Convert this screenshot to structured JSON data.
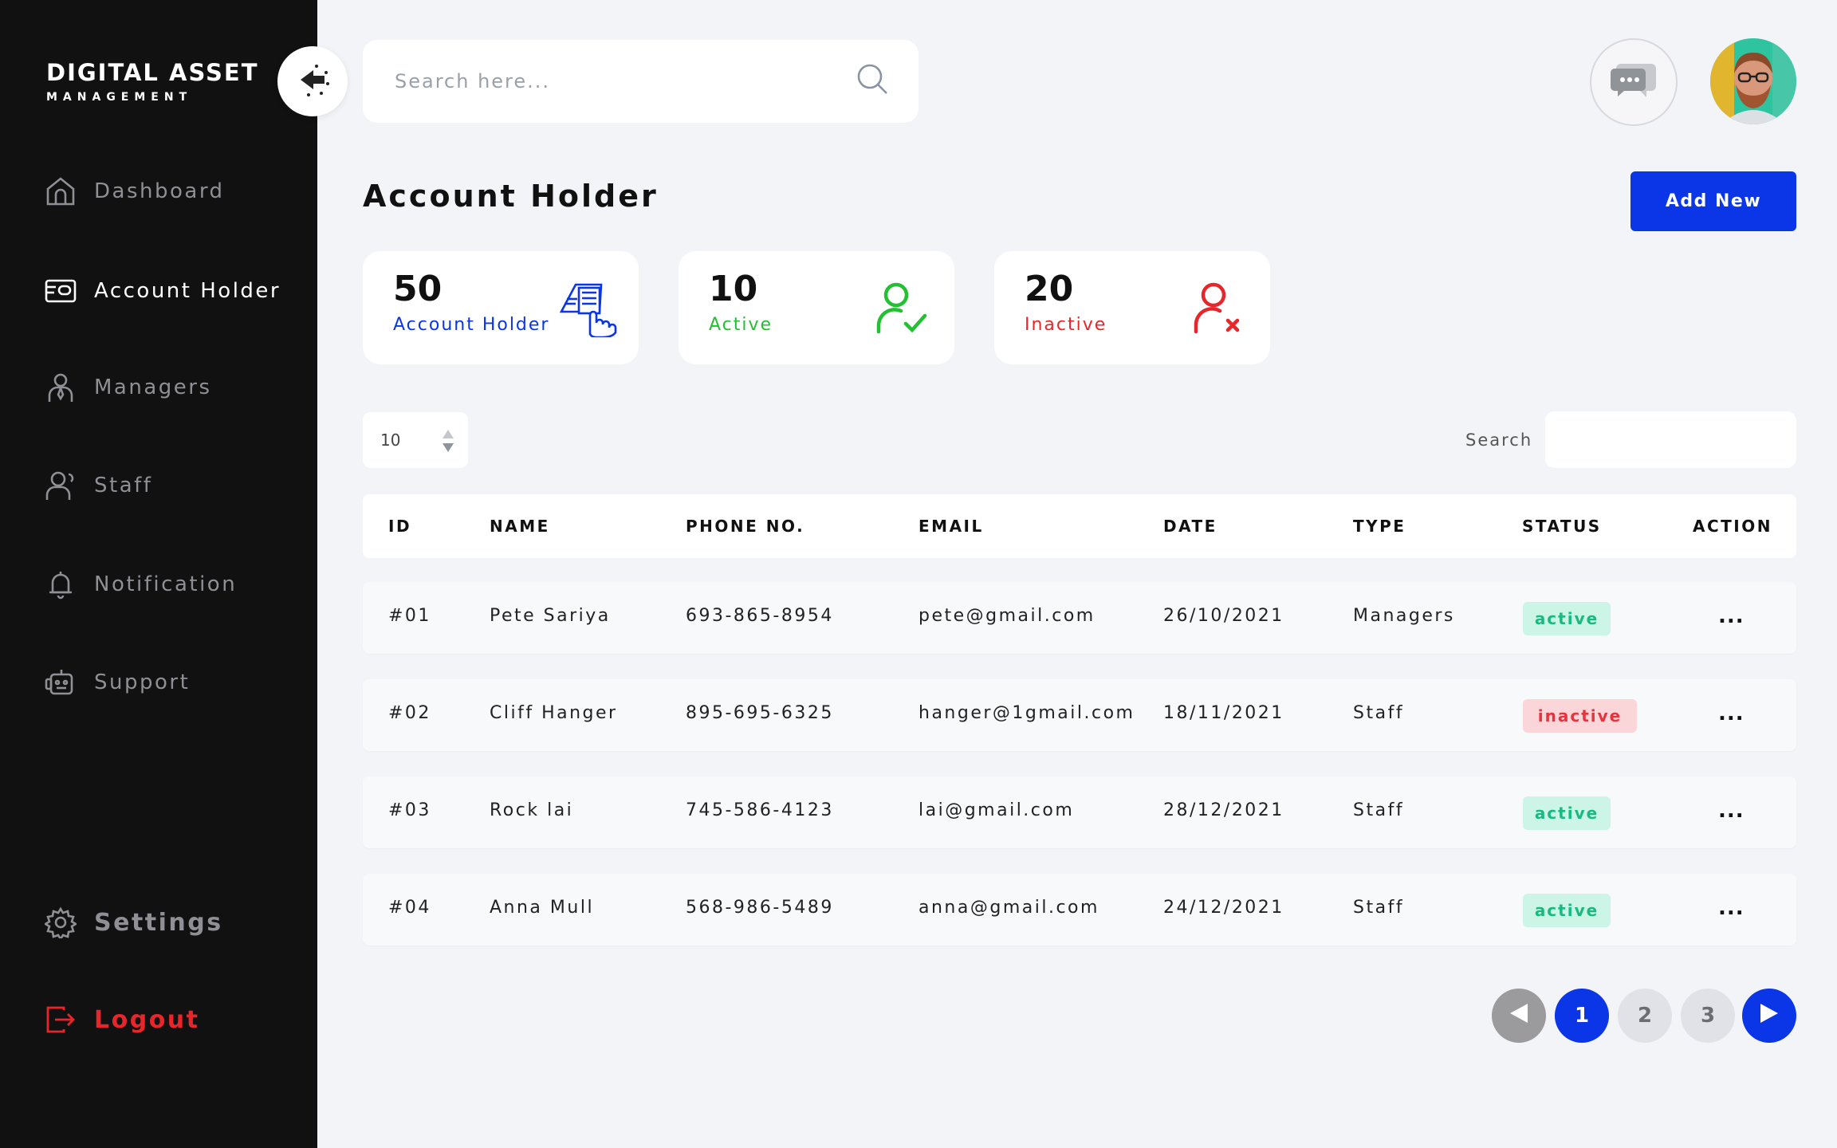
{
  "brand": {
    "title": "DIGITAL ASSET",
    "subtitle": "MANAGEMENT"
  },
  "sidebar": {
    "items": [
      {
        "label": "Dashboard",
        "icon": "home-icon"
      },
      {
        "label": "Account Holder",
        "icon": "card-icon",
        "active": true
      },
      {
        "label": "Managers",
        "icon": "manager-icon"
      },
      {
        "label": "Staff",
        "icon": "staff-icon"
      },
      {
        "label": "Notification",
        "icon": "bell-icon"
      },
      {
        "label": "Support",
        "icon": "support-icon"
      }
    ],
    "settings_label": "Settings",
    "logout_label": "Logout"
  },
  "search": {
    "placeholder": "Search here..."
  },
  "page": {
    "title": "Account Holder",
    "add_label": "Add New"
  },
  "cards": [
    {
      "value": "50",
      "label": "Account Holder",
      "color": "#0a36e8"
    },
    {
      "value": "10",
      "label": "Active",
      "color": "#21c131"
    },
    {
      "value": "20",
      "label": "Inactive",
      "color": "#e8262a"
    }
  ],
  "table": {
    "page_length": "10",
    "search_label": "Search",
    "columns": [
      "ID",
      "NAME",
      "PHONE NO.",
      "EMAIL",
      "DATE",
      "TYPE",
      "STATUS",
      "ACTION"
    ],
    "rows": [
      {
        "id": "#01",
        "name": "Pete Sariya",
        "phone": "693-865-8954",
        "email": "pete@gmail.com",
        "date": "26/10/2021",
        "type": "Managers",
        "status": "active",
        "action": "..."
      },
      {
        "id": "#02",
        "name": "Cliff Hanger",
        "phone": "895-695-6325",
        "email": "hanger@1gmail.com",
        "date": "18/11/2021",
        "type": "Staff",
        "status": "inactive",
        "action": "..."
      },
      {
        "id": "#03",
        "name": "Rock lai",
        "phone": "745-586-4123",
        "email": "lai@gmail.com",
        "date": "28/12/2021",
        "type": "Staff",
        "status": "active",
        "action": "..."
      },
      {
        "id": "#04",
        "name": "Anna Mull",
        "phone": "568-986-5489",
        "email": "anna@gmail.com",
        "date": "24/12/2021",
        "type": "Staff",
        "status": "active",
        "action": "..."
      }
    ]
  },
  "pagination": {
    "pages": [
      "1",
      "2",
      "3"
    ],
    "current": "1"
  },
  "colors": {
    "accent": "#0a36e8",
    "sidebar": "#111111",
    "active": "#19b981",
    "inactive": "#e8323c"
  }
}
